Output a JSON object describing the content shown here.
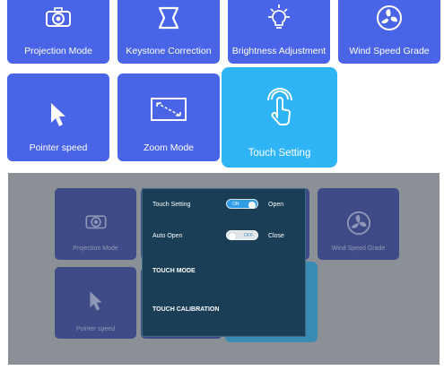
{
  "tiles": [
    {
      "label": "Projection Mode",
      "icon": "projector-icon"
    },
    {
      "label": "Keystone Correction",
      "icon": "keystone-icon"
    },
    {
      "label": "Brightness Adjustment",
      "icon": "bulb-icon"
    },
    {
      "label": "Wind Speed Grade",
      "icon": "fan-icon"
    },
    {
      "label": "Pointer speed",
      "icon": "pointer-icon"
    },
    {
      "label": "Zoom Mode",
      "icon": "zoom-icon"
    },
    {
      "label": "Touch Setting",
      "icon": "touch-icon"
    }
  ],
  "overlay": {
    "bg_tiles": [
      {
        "label": "Projection Mode"
      },
      {
        "label": "Wind Speed Grade"
      },
      {
        "label": "Pointer speed"
      }
    ],
    "panel": {
      "touch_setting": {
        "label": "Touch Setting",
        "toggle": "ON",
        "value": "Open"
      },
      "auto_open": {
        "label": "Auto Open",
        "toggle": "OFF",
        "value": "Close"
      },
      "touch_mode": "TOUCH MODE",
      "touch_calibration": "TOUCH CALIBRATION"
    }
  },
  "colors": {
    "tile": "#4a64e8",
    "selected": "#2fb4f5",
    "panel": "#1a3e56"
  }
}
